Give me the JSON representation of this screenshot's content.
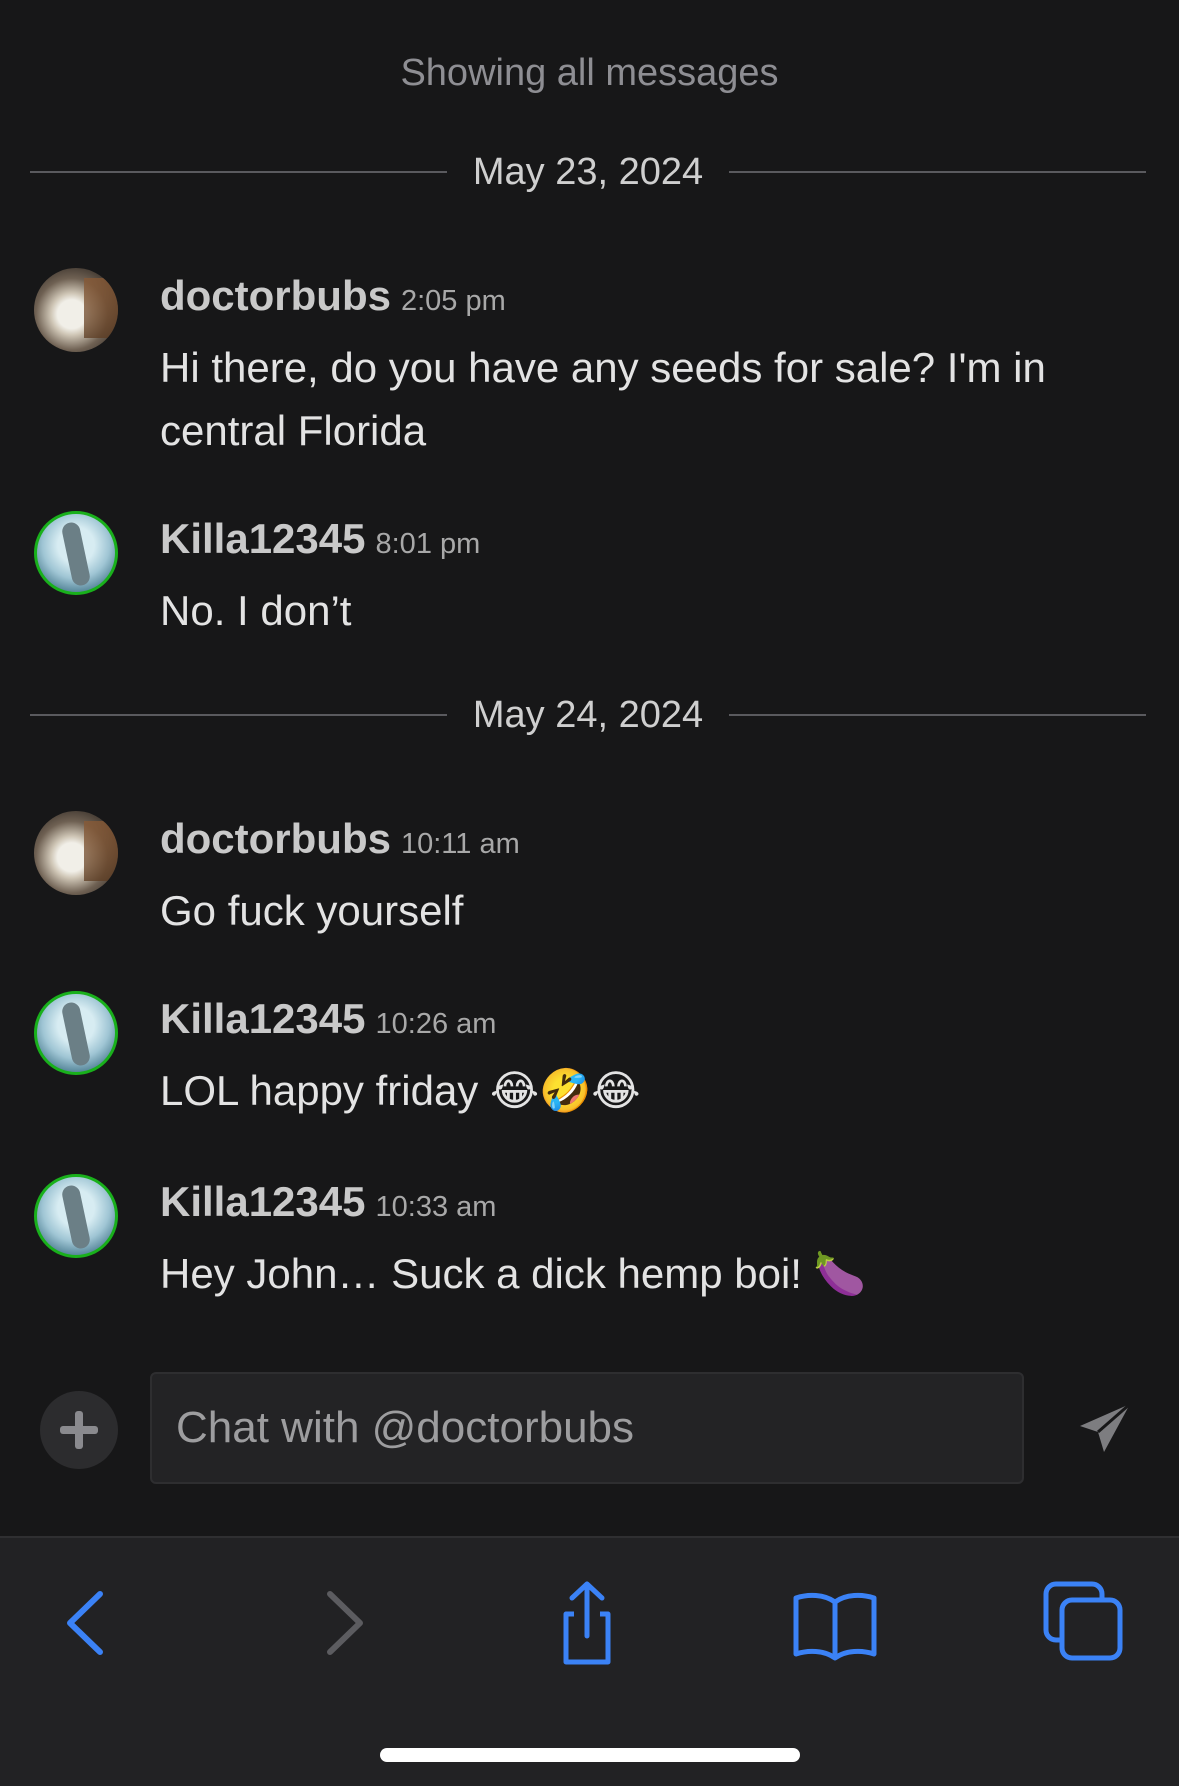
{
  "header": {
    "status_text": "Showing all messages"
  },
  "dates": [
    {
      "label": "May 23, 2024"
    },
    {
      "label": "May 24, 2024"
    }
  ],
  "messages": [
    {
      "user": "doctorbubs",
      "time": "2:05 pm",
      "text": "Hi there, do you have any seeds for sale? I'm in central Florida",
      "avatar": "dog-avatar"
    },
    {
      "user": "Killa12345",
      "time": "8:01 pm",
      "text": "No. I don’t",
      "avatar": "dolphin-avatar"
    },
    {
      "user": "doctorbubs",
      "time": "10:11 am",
      "text": "Go fuck yourself",
      "avatar": "dog-avatar"
    },
    {
      "user": "Killa12345",
      "time": "10:26 am",
      "text": "LOL happy friday 😂🤣😂",
      "avatar": "dolphin-avatar"
    },
    {
      "user": "Killa12345",
      "time": "10:33 am",
      "text": "Hey John… Suck a dick hemp boi! 🍆",
      "avatar": "dolphin-avatar"
    }
  ],
  "composer": {
    "placeholder": "Chat with @doctorbubs",
    "add_icon": "plus-icon",
    "send_icon": "paper-plane-icon"
  },
  "browser_toolbar": {
    "icons": [
      "back-icon",
      "forward-icon",
      "share-icon",
      "bookmarks-icon",
      "tabs-icon"
    ],
    "accent_color": "#3b82f6",
    "disabled_color": "#5c5c60"
  },
  "colors": {
    "background": "#171718",
    "online_ring": "#19b01b"
  }
}
